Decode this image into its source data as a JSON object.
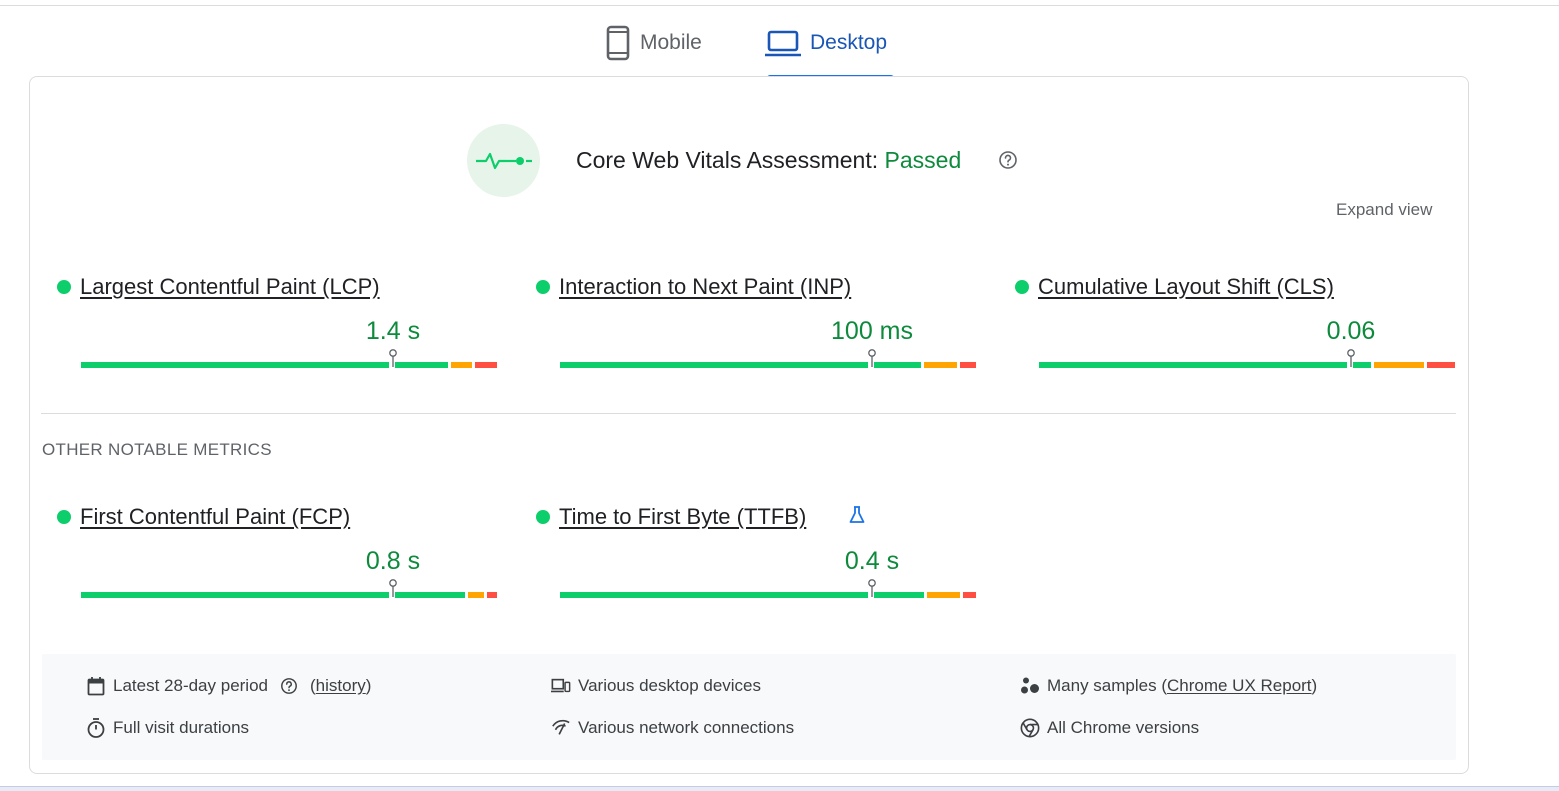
{
  "tabs": [
    {
      "label": "Mobile",
      "selected": false
    },
    {
      "label": "Desktop",
      "selected": true
    }
  ],
  "assessment": {
    "label": "Core Web Vitals Assessment:",
    "status": "Passed",
    "status_color": "#0d8a3c",
    "expand_label": "Expand view"
  },
  "core_metrics": [
    {
      "name": "Largest Contentful Paint (LCP)",
      "value": "1.4 s",
      "status": "good"
    },
    {
      "name": "Interaction to Next Paint (INP)",
      "value": "100 ms",
      "status": "good"
    },
    {
      "name": "Cumulative Layout Shift (CLS)",
      "value": "0.06",
      "status": "good"
    }
  ],
  "other_section_label": "OTHER NOTABLE METRICS",
  "other_metrics": [
    {
      "name": "First Contentful Paint (FCP)",
      "value": "0.8 s",
      "status": "good"
    },
    {
      "name": "Time to First Byte (TTFB)",
      "value": "0.4 s",
      "status": "good",
      "experimental": true
    }
  ],
  "info": {
    "period": "Latest 28-day period",
    "history_open": "(",
    "history_link": "history",
    "history_close": ")",
    "devices": "Various desktop devices",
    "samples_prefix": "Many samples (",
    "samples_link": "Chrome UX Report",
    "samples_suffix": ")",
    "durations": "Full visit durations",
    "network": "Various network connections",
    "chrome": "All Chrome versions"
  },
  "colors": {
    "good": "#0cce6b",
    "needs_improvement": "#ffa400",
    "poor": "#ff4e42",
    "accent": "#1a73e8"
  }
}
